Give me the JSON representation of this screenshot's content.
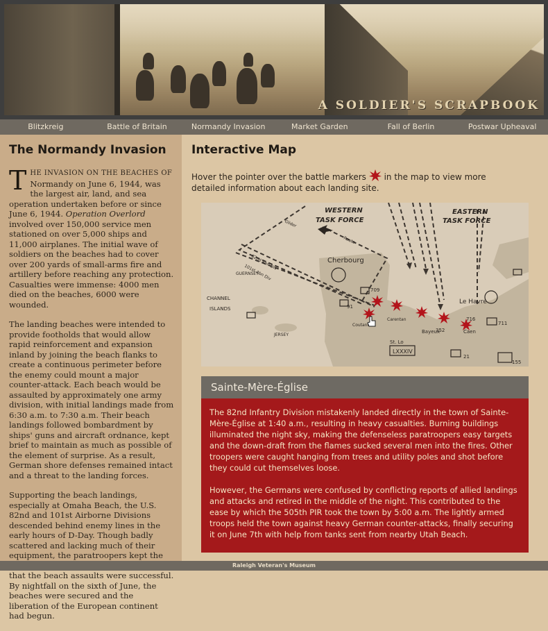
{
  "site": {
    "title": "A SOLDIER'S SCRAPBOOK",
    "footer": "Raleigh Veteran's Museum"
  },
  "nav": {
    "items": [
      {
        "label": "Blitzkreig"
      },
      {
        "label": "Battle of Britain"
      },
      {
        "label": "Normandy Invasion"
      },
      {
        "label": "Market Garden"
      },
      {
        "label": "Fall of Berlin"
      },
      {
        "label": "Postwar Upheaval"
      }
    ]
  },
  "article": {
    "heading": "The Normandy Invasion",
    "dropcap": "T",
    "lead_caps": "HE INVASION ON THE BEACHES OF",
    "p1_rest": " Normandy on June 6, 1944, was the largest air, land, and sea operation undertaken before or since June 6, 1944. ",
    "p1_italic": "Operation Overlord",
    "p1_tail": " involved over 150,000 service men stationed on over 5,000 ships and 11,000 airplanes. The initial wave of soldiers on the beaches had to cover over 200 yards of small-arms fire and artillery before reaching any protection. Casualties were immense: 4000 men died on the beaches, 6000 were wounded.",
    "p2": "The landing beaches were intended to provide footholds that would allow rapid reinforcement and expansion inland by joining the beach flanks to create a continuous perimeter before the enemy could mount a major counter-attack. Each beach would be assaulted by approximately one army division, with initial landings made from 6:30 a.m. to 7:30 a.m. Their beach landings followed bombardment by ships' guns and aircraft ordnance, kept brief to maintain as much as possible of the element of surprise. As a result, German shore defenses remained intact and a threat to the landing forces.",
    "p3": "Supporting the beach landings, especially at Omaha Beach, the U.S. 82nd and 101st Airborne Divisions descended behind enemy lines in the early hours of D-Day. Though badly scattered and lacking much of their equipment, the paratroopers kept the Germans occupied and helped ensure that the beach assaults were successful. By nightfall on the sixth of June, the beaches were secured and the liberation of the European continent had begun."
  },
  "map_section": {
    "heading": "Interactive Map",
    "intro_before": "Hover the pointer over the battle markers",
    "intro_after": "in the map to view more detailed information about each landing site.",
    "labels": {
      "western": "WESTERN",
      "western2": "TASK FORCE",
      "eastern": "EASTERN",
      "eastern2": "TASK FORCE",
      "cherbourg": "Cherbourg",
      "channel": "CHANNEL",
      "islands": "ISLANDS",
      "le_havre": "Le Havre",
      "jersey": "JERSEY",
      "guernsey": "GUERNSEY",
      "glider": "Glider",
      "route": "Route",
      "abn": "82nd Abn Div",
      "abn101": "101st Abn Div",
      "bayeux": "Bayeux",
      "caen": "Caen",
      "lxxxiv": "LXXXIV",
      "st_lo": "St. Lo",
      "carentan": "Carentan",
      "num709": "709",
      "num711": "711",
      "num716": "716",
      "num352": "352",
      "num91": "91",
      "num21": "21",
      "num155": "155",
      "coutances": "Coutances"
    }
  },
  "detail": {
    "title": "Sainte-Mère-Église",
    "p1": "The 82nd Infantry Division mistakenly landed directly in the town of Sainte-Mère-Église at 1:40 a.m., resulting in heavy casualties. Burning buildings illuminated the night sky, making the defenseless paratroopers easy targets and the down-draft from the flames sucked several men into the fires. Other troopers were caught hanging from trees and utility poles and shot before they could cut themselves loose.",
    "p2": "However, the Germans were confused by conflicting reports of allied landings and attacks and retired in the middle of the night. This contributed to the ease by which the 505th PIR took the town by 5:00 a.m. The lightly armed troops held the town against heavy German counter-attacks, finally securing it on June 7th with help from tanks sent from nearby Utah Beach."
  },
  "colors": {
    "marker": "#b3141b",
    "panel_red": "#a4191b",
    "panel_gray": "#6e6a63",
    "nav": "#6f6960"
  },
  "icons": {
    "marker": "starburst-marker-icon",
    "cursor": "hand-pointer-icon"
  }
}
